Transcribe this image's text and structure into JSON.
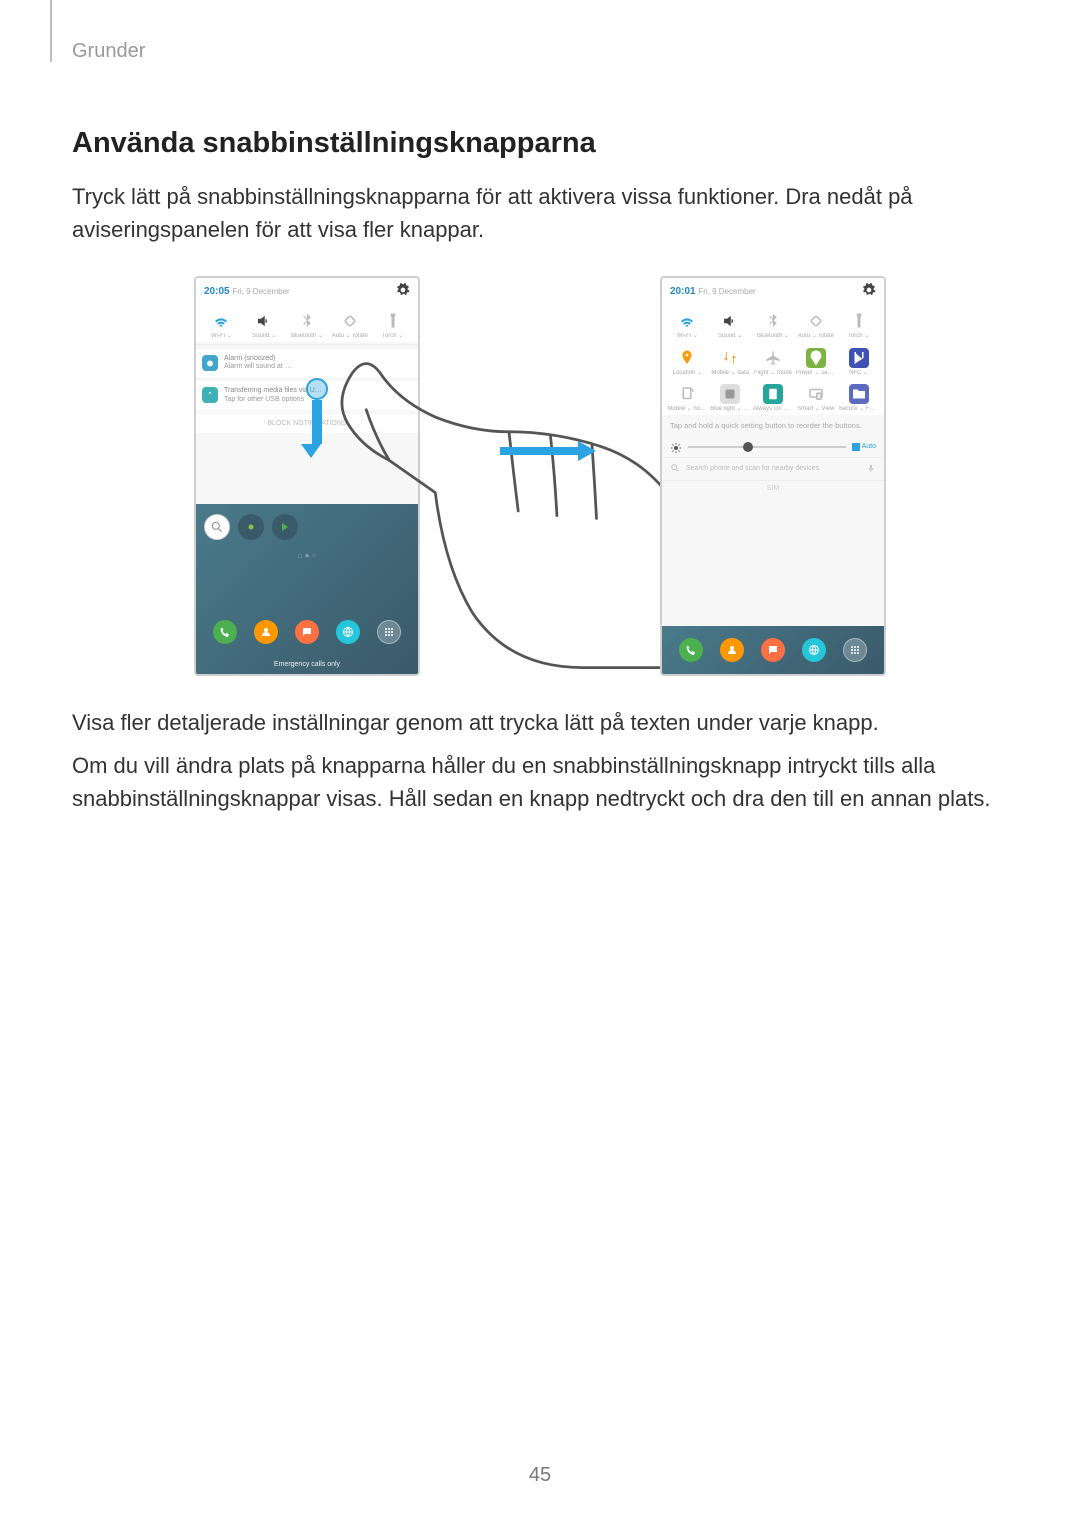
{
  "breadcrumb": "Grunder",
  "section_title": "Använda snabbinställningsknapparna",
  "intro_text": "Tryck lätt på snabbinställningsknapparna för att aktivera vissa funktioner. Dra nedåt på aviseringspanelen för att visa fler knappar.",
  "after_fig_p1": "Visa fler detaljerade inställningar genom att trycka lätt på texten under varje knapp.",
  "after_fig_p2": "Om du vill ändra plats på knapparna håller du en snabbinställningsknapp intryckt tills alla snabbinställningsknappar visas. Håll sedan en knapp nedtryckt och dra den till en annan plats.",
  "page_number": "45",
  "phone1": {
    "time": "20:05",
    "date": "Fri, 9 December",
    "row1": [
      {
        "icon": "wifi",
        "label": "Wi-Fi ⌄",
        "tint": "#2aa3e0"
      },
      {
        "icon": "sound",
        "label": "Sound ⌄",
        "tint": "#555"
      },
      {
        "icon": "bluetooth",
        "label": "Bluetooth ⌄",
        "tint": "#999"
      },
      {
        "icon": "rotate",
        "label": "Auto ⌄ rotate",
        "tint": "#999"
      },
      {
        "icon": "torch",
        "label": "Torch ⌄",
        "tint": "#999"
      }
    ],
    "notif1": {
      "title": "Alarm (snoozed)",
      "sub": "Alarm will sound at …"
    },
    "notif2": {
      "title": "Transferring media files via U…",
      "sub": "Tap for other USB options"
    },
    "block_text": "BLOCK NOTIFICATIONS",
    "emergency": "Emergency calls only"
  },
  "phone2": {
    "time": "20:01",
    "date": "Fri, 9 December",
    "row1": [
      {
        "icon": "wifi",
        "label": "Wi-Fi ⌄",
        "tint": "#2aa3e0"
      },
      {
        "icon": "sound",
        "label": "Sound ⌄",
        "tint": "#555"
      },
      {
        "icon": "bluetooth",
        "label": "Bluetooth ⌄",
        "tint": "#999"
      },
      {
        "icon": "rotate",
        "label": "Auto ⌄ rotate",
        "tint": "#999"
      },
      {
        "icon": "torch",
        "label": "Torch ⌄",
        "tint": "#999"
      }
    ],
    "row2": [
      {
        "icon": "location",
        "label": "Location ⌄",
        "tint": "#ff9800"
      },
      {
        "icon": "mobiledata",
        "label": "Mobile ⌄ data",
        "tint": "#ff9800"
      },
      {
        "icon": "flight",
        "label": "Flight ⌄ mode",
        "tint": "#999"
      },
      {
        "icon": "power",
        "label": "Power ⌄ saving",
        "tint": "#4caf50"
      },
      {
        "icon": "nfc",
        "label": "NFC ⌄",
        "tint": "#3f51b5"
      }
    ],
    "row3": [
      {
        "icon": "hotspot",
        "label": "Mobile ⌄ hotspot",
        "tint": "#bbb"
      },
      {
        "icon": "bluelight",
        "label": "Blue light ⌄ filter",
        "tint": "#bbb"
      },
      {
        "icon": "alwayson",
        "label": "Always On ⌄ Display",
        "tint": "#4caf50"
      },
      {
        "icon": "smartview",
        "label": "Smart ⌄ View",
        "tint": "#bbb"
      },
      {
        "icon": "secure",
        "label": "Secure ⌄ Folder",
        "tint": "#3f51b5"
      }
    ],
    "hint": "Tap and hold a quick setting button to reorder the buttons.",
    "auto_label": "Auto",
    "search_placeholder": "Search phone and scan for nearby devices",
    "sim_label": "SIM"
  }
}
